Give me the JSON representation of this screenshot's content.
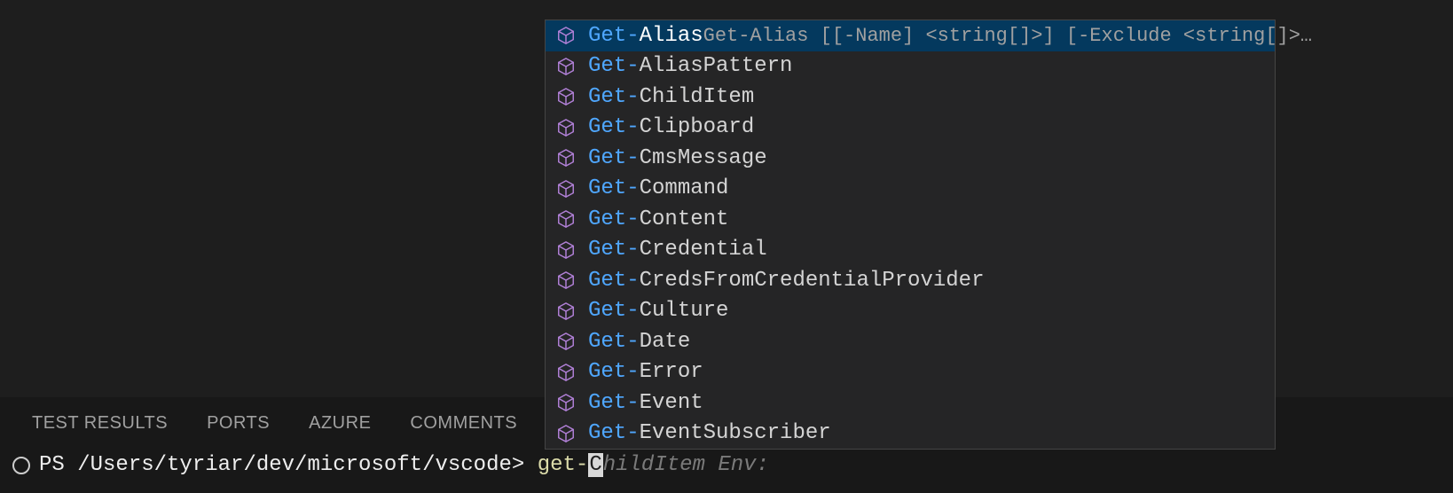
{
  "colors": {
    "accent": "#4fa7ff",
    "iconStroke": "#b180d7",
    "cmd": "#dcdcaa"
  },
  "panel": {
    "tabs": [
      {
        "label": "TEST RESULTS"
      },
      {
        "label": "PORTS"
      },
      {
        "label": "AZURE"
      },
      {
        "label": "COMMENTS"
      }
    ]
  },
  "terminal": {
    "prompt": "PS /Users/tyriar/dev/microsoft/vscode> ",
    "typed": "get-",
    "cursorChar": "C",
    "ghost": "hildItem Env:"
  },
  "suggest": {
    "signature": "Get-Alias [[-Name] <string[]>] [-Exclude <string[]>…",
    "selectedIndex": 0,
    "items": [
      {
        "prefix": "Get-",
        "rest": "Alias"
      },
      {
        "prefix": "Get-",
        "rest": "AliasPattern"
      },
      {
        "prefix": "Get-",
        "rest": "ChildItem"
      },
      {
        "prefix": "Get-",
        "rest": "Clipboard"
      },
      {
        "prefix": "Get-",
        "rest": "CmsMessage"
      },
      {
        "prefix": "Get-",
        "rest": "Command"
      },
      {
        "prefix": "Get-",
        "rest": "Content"
      },
      {
        "prefix": "Get-",
        "rest": "Credential"
      },
      {
        "prefix": "Get-",
        "rest": "CredsFromCredentialProvider"
      },
      {
        "prefix": "Get-",
        "rest": "Culture"
      },
      {
        "prefix": "Get-",
        "rest": "Date"
      },
      {
        "prefix": "Get-",
        "rest": "Error"
      },
      {
        "prefix": "Get-",
        "rest": "Event"
      },
      {
        "prefix": "Get-",
        "rest": "EventSubscriber"
      }
    ]
  }
}
